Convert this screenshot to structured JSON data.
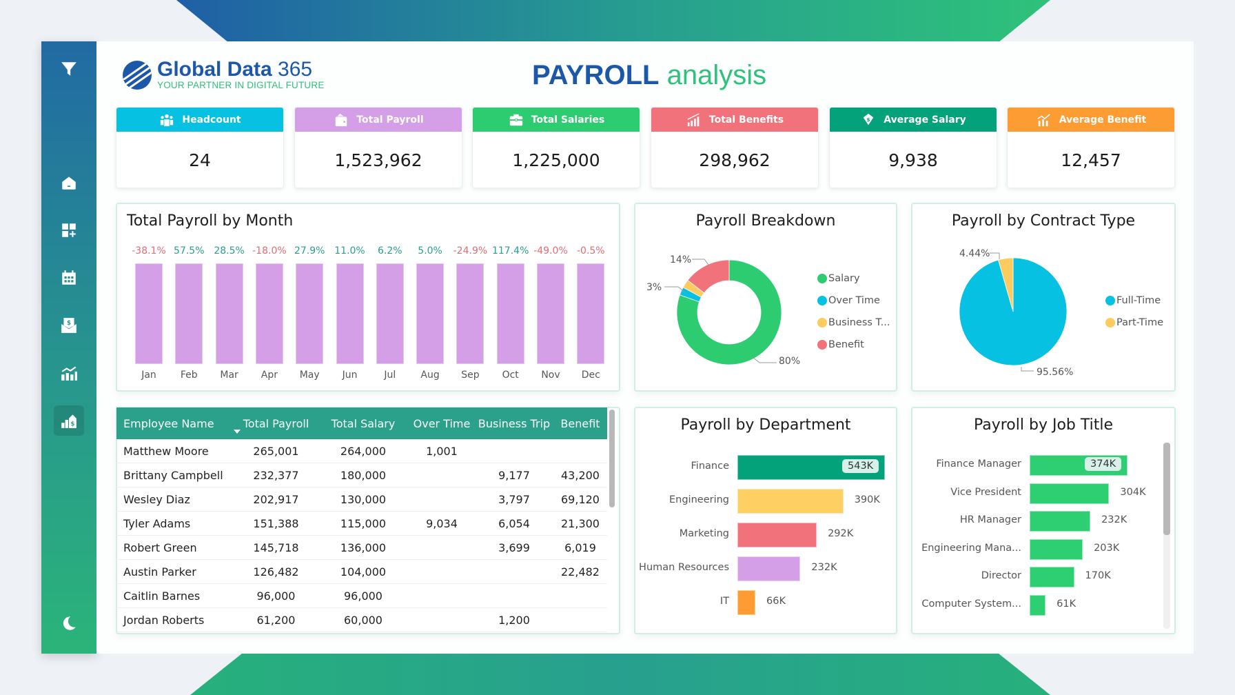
{
  "header": {
    "logo_name": "Global Data",
    "logo_number": "365",
    "logo_tagline": "YOUR PARTNER IN DIGITAL FUTURE",
    "title_bold": "PAYROLL",
    "title_light": "analysis"
  },
  "sidebar": {
    "items": [
      {
        "icon": "filter-icon"
      },
      {
        "icon": "home-icon"
      },
      {
        "icon": "dashboard-add-icon"
      },
      {
        "icon": "calendar-icon"
      },
      {
        "icon": "payroll-envelope-icon"
      },
      {
        "icon": "analytics-icon"
      },
      {
        "icon": "payroll-house-icon",
        "active": true
      },
      {
        "icon": "dark-mode-moon-icon"
      }
    ]
  },
  "kpis": [
    {
      "label": "Headcount",
      "value": "24",
      "color": "#06c1e1",
      "icon": "people-icon"
    },
    {
      "label": "Total Payroll",
      "value": "1,523,962",
      "color": "#d49fe6",
      "icon": "wallet-icon"
    },
    {
      "label": "Total Salaries",
      "value": "1,225,000",
      "color": "#2ecc71",
      "icon": "briefcase-icon"
    },
    {
      "label": "Total Benefits",
      "value": "298,962",
      "color": "#f2727c",
      "icon": "growth-chart-icon"
    },
    {
      "label": "Average Salary",
      "value": "9,938",
      "color": "#04a27a",
      "icon": "money-icon"
    },
    {
      "label": "Average Benefit",
      "value": "12,457",
      "color": "#fd9c33",
      "icon": "bar-growth-icon"
    }
  ],
  "colors": {
    "positive": "#2a9d8f",
    "negative": "#e06c75",
    "month_bar": "#d49fe6"
  },
  "chart_data": [
    {
      "type": "bar",
      "title": "Total Payroll by Month",
      "categories": [
        "Jan",
        "Feb",
        "Mar",
        "Apr",
        "May",
        "Jun",
        "Jul",
        "Aug",
        "Sep",
        "Oct",
        "Nov",
        "Dec"
      ],
      "values": [
        1,
        1,
        1,
        1,
        1,
        1,
        1,
        1,
        1,
        1,
        1,
        1
      ],
      "data_labels": [
        "-38.1%",
        "57.5%",
        "28.5%",
        "-18.0%",
        "27.9%",
        "11.0%",
        "6.2%",
        "5.0%",
        "-24.9%",
        "117.4%",
        "-49.0%",
        "-0.5%"
      ],
      "xlabel": "",
      "ylabel": ""
    },
    {
      "type": "pie",
      "title": "Payroll Breakdown",
      "donut": true,
      "labels": [
        "Salary",
        "Over Time",
        "Business T...",
        "Benefit"
      ],
      "values": [
        80.4,
        2.5,
        2.6,
        14.5
      ],
      "data_labels": [
        "80%",
        "3%",
        "",
        "14%"
      ],
      "colors": [
        "#2ecc71",
        "#06c1e1",
        "#fecb5f",
        "#f2727c"
      ],
      "legend": "right"
    },
    {
      "type": "pie",
      "title": "Payroll by Contract Type",
      "labels": [
        "Full-Time",
        "Part-Time"
      ],
      "values": [
        95.56,
        4.44
      ],
      "data_labels": [
        "95.56%",
        "4.44%"
      ],
      "colors": [
        "#06c1e1",
        "#fecb5f"
      ],
      "legend": "right"
    },
    {
      "type": "bar",
      "orientation": "horizontal",
      "title": "Payroll by Department",
      "categories": [
        "Finance",
        "Engineering",
        "Marketing",
        "Human Resources",
        "IT"
      ],
      "values": [
        543,
        390,
        292,
        232,
        66
      ],
      "data_labels": [
        "543K",
        "390K",
        "292K",
        "232K",
        "66K"
      ],
      "colors": [
        "#04a27a",
        "#fecf63",
        "#f2727c",
        "#d49fe6",
        "#fd9c33"
      ],
      "unit": "K"
    },
    {
      "type": "bar",
      "orientation": "horizontal",
      "title": "Payroll by Job Title",
      "categories": [
        "Finance Manager",
        "Vice President",
        "HR Manager",
        "Engineering Mana...",
        "Director",
        "Computer System..."
      ],
      "values": [
        374,
        304,
        232,
        203,
        170,
        61
      ],
      "data_labels": [
        "374K",
        "304K",
        "232K",
        "203K",
        "170K",
        "61K"
      ],
      "colors": [
        "#2ecf73"
      ],
      "unit": "K"
    }
  ],
  "table": {
    "columns": [
      "Employee Name",
      "Total Payroll",
      "Total Salary",
      "Over Time",
      "Business Trip",
      "Benefit"
    ],
    "sorted_column": "Total Payroll",
    "rows": [
      [
        "Matthew Moore",
        "265,001",
        "264,000",
        "1,001",
        "",
        ""
      ],
      [
        "Brittany Campbell",
        "232,377",
        "180,000",
        "",
        "9,177",
        "43,200"
      ],
      [
        "Wesley Diaz",
        "202,917",
        "130,000",
        "",
        "3,797",
        "69,120"
      ],
      [
        "Tyler Adams",
        "151,388",
        "115,000",
        "9,034",
        "6,054",
        "21,300"
      ],
      [
        "Robert Green",
        "145,718",
        "136,000",
        "",
        "3,699",
        "6,019"
      ],
      [
        "Austin Parker",
        "126,482",
        "104,000",
        "",
        "",
        "22,482"
      ],
      [
        "Caitlin Barnes",
        "96,000",
        "96,000",
        "",
        "",
        ""
      ],
      [
        "Jordan Roberts",
        "61,200",
        "60,000",
        "",
        "1,200",
        ""
      ]
    ]
  }
}
